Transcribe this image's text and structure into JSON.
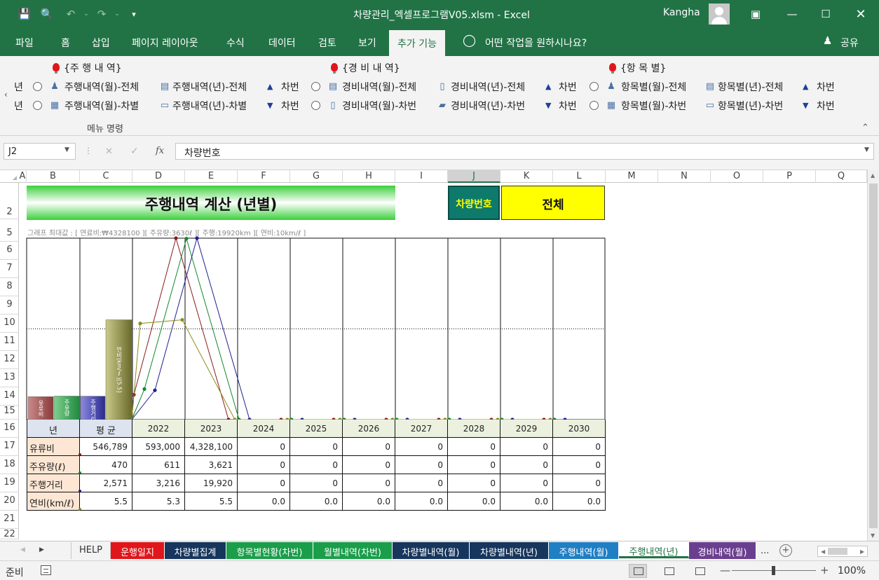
{
  "app": {
    "window_title": "차량관리_엑셀프로그램V05.xlsm  -  Excel",
    "user": "Kangha"
  },
  "ribbon_tabs": [
    "파일",
    "홈",
    "삽입",
    "페이지 레이아웃",
    "수식",
    "데이터",
    "검토",
    "보기",
    "추가 기능"
  ],
  "active_ribbon_tab": "추가 기능",
  "tell_me": "어떤 작업을 원하시나요?",
  "share": "공유",
  "ribbon": {
    "group_label": "메뉴 명령",
    "cut_left": "년",
    "sections": [
      {
        "header": "{주 행 내 역}",
        "row1": [
          "주행내역(월)-전체",
          "주행내역(년)-전체",
          "차번"
        ],
        "row2": [
          "주행내역(월)-차별",
          "주행내역(년)-차별",
          "차번"
        ]
      },
      {
        "header": "{경 비 내 역}",
        "row1": [
          "경비내역(월)-전체",
          "경비내역(년)-전체",
          "차번"
        ],
        "row2": [
          "경비내역(월)-차번",
          "경비내역(년)-차번",
          "차번"
        ]
      },
      {
        "header": "{항 목 별}",
        "row1": [
          "항목별(월)-전체",
          "항목별(년)-전체",
          "차번"
        ],
        "row2": [
          "항목별(월)-차번",
          "항목별(년)-차번",
          "차번"
        ]
      }
    ]
  },
  "formula_bar": {
    "name_box": "J2",
    "formula": "차량번호"
  },
  "columns": [
    "A",
    "B",
    "C",
    "D",
    "E",
    "F",
    "G",
    "H",
    "I",
    "J",
    "K",
    "L",
    "M",
    "N",
    "O",
    "P",
    "Q"
  ],
  "selected_column": "J",
  "rows": [
    "2",
    "5",
    "6",
    "7",
    "8",
    "9",
    "10",
    "11",
    "12",
    "13",
    "14",
    "15",
    "16",
    "17",
    "18",
    "19",
    "20",
    "21",
    "22"
  ],
  "sheet": {
    "title": "주행내역 계산 (년별)",
    "car_label": "차량번호",
    "car_value": "전체",
    "chart_max_note": "그래프 최대값 : [ 연료비:₩4328100 ][ 주유량:3630ℓ ][ 주행:19920km ][ 연비:10km/ℓ ]"
  },
  "chart_data": {
    "type": "line",
    "x": [
      "2022",
      "2023",
      "2024",
      "2025",
      "2026",
      "2027",
      "2028",
      "2029",
      "2030"
    ],
    "series": [
      {
        "name": "유류비",
        "color": "#8b1a1a",
        "values": [
          593000,
          4328100,
          0,
          0,
          0,
          0,
          0,
          0,
          0
        ]
      },
      {
        "name": "주유량(ℓ)",
        "color": "#0f8a2e",
        "values": [
          611,
          3621,
          0,
          0,
          0,
          0,
          0,
          0,
          0
        ]
      },
      {
        "name": "주행거리",
        "color": "#1f1f8f",
        "values": [
          3216,
          19920,
          0,
          0,
          0,
          0,
          0,
          0,
          0
        ]
      },
      {
        "name": "연비(km/ℓ)",
        "color": "#8c8c1a",
        "values": [
          5.3,
          5.5,
          0,
          0,
          0,
          0,
          0,
          0,
          0
        ]
      }
    ],
    "series_max": [
      4328100,
      3630,
      19920,
      10
    ],
    "average_bars": [
      {
        "label": "유류비",
        "color_top": "#c98a8a",
        "color_bottom": "#8b3a3a",
        "value": 546789
      },
      {
        "label": "주유량",
        "color_top": "#7fd08f",
        "color_bottom": "#1f8a3e",
        "value": 470
      },
      {
        "label": "주행거리",
        "color_top": "#8a8ae0",
        "color_bottom": "#2a2a8f",
        "value": 2571
      },
      {
        "label": "연비(km/ℓ)[5.5]",
        "color_top": "#c9c98a",
        "color_bottom": "#6a6a2a",
        "value": 5.5
      }
    ]
  },
  "table": {
    "year_header": "년",
    "avg_header": "평 균",
    "years": [
      "2022",
      "2023",
      "2024",
      "2025",
      "2026",
      "2027",
      "2028",
      "2029",
      "2030"
    ],
    "rows": [
      {
        "label": "유류비",
        "avg": "546,789",
        "values": [
          "593,000",
          "4,328,100",
          "0",
          "0",
          "0",
          "0",
          "0",
          "0",
          "0"
        ]
      },
      {
        "label": "주유량(ℓ)",
        "avg": "470",
        "values": [
          "611",
          "3,621",
          "0",
          "0",
          "0",
          "0",
          "0",
          "0",
          "0"
        ]
      },
      {
        "label": "주행거리",
        "avg": "2,571",
        "values": [
          "3,216",
          "19,920",
          "0",
          "0",
          "0",
          "0",
          "0",
          "0",
          "0"
        ]
      },
      {
        "label": "연비(km/ℓ)",
        "avg": "5.5",
        "values": [
          "5.3",
          "5.5",
          "0.0",
          "0.0",
          "0.0",
          "0.0",
          "0.0",
          "0.0",
          "0.0"
        ]
      }
    ]
  },
  "sheet_tabs": [
    {
      "label": "HELP",
      "color": ""
    },
    {
      "label": "운행일지",
      "color": "#e0161a"
    },
    {
      "label": "차량별집계",
      "color": "#17365d"
    },
    {
      "label": "항목별현황(차번)",
      "color": "#1a9e4a"
    },
    {
      "label": "월별내역(차번)",
      "color": "#1a9e4a"
    },
    {
      "label": "차량별내역(월)",
      "color": "#17365d"
    },
    {
      "label": "차량별내역(년)",
      "color": "#17365d"
    },
    {
      "label": "주행내역(월)",
      "color": "#1f7fc4"
    },
    {
      "label": "주행내역(년)",
      "color": "#1f7fc4"
    },
    {
      "label": "경비내역(월)",
      "color": "#6b3f8f"
    }
  ],
  "active_sheet_tab": "주행내역(년)",
  "more_tabs": "...",
  "status": {
    "ready": "준비",
    "zoom": "100%"
  }
}
